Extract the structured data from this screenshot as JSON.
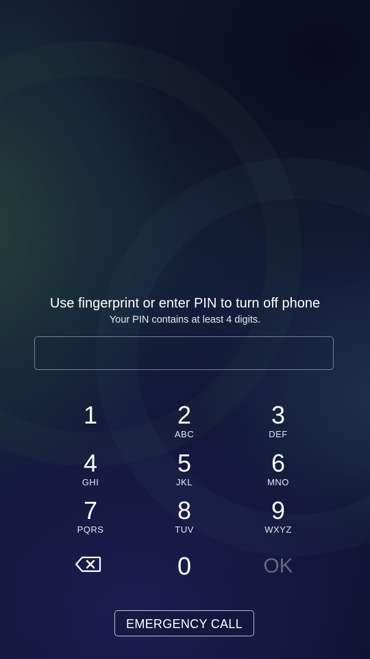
{
  "prompt": {
    "title": "Use fingerprint or enter PIN to turn off phone",
    "subtitle": "Your PIN contains at least 4 digits."
  },
  "pin_field": {
    "value": "",
    "placeholder": ""
  },
  "keypad": {
    "k1": {
      "digit": "1",
      "letters": ""
    },
    "k2": {
      "digit": "2",
      "letters": "ABC"
    },
    "k3": {
      "digit": "3",
      "letters": "DEF"
    },
    "k4": {
      "digit": "4",
      "letters": "GHI"
    },
    "k5": {
      "digit": "5",
      "letters": "JKL"
    },
    "k6": {
      "digit": "6",
      "letters": "MNO"
    },
    "k7": {
      "digit": "7",
      "letters": "PQRS"
    },
    "k8": {
      "digit": "8",
      "letters": "TUV"
    },
    "k9": {
      "digit": "9",
      "letters": "WXYZ"
    },
    "k0": {
      "digit": "0"
    },
    "ok": {
      "label": "OK"
    },
    "backspace": {
      "icon": "backspace-icon"
    }
  },
  "emergency_call": {
    "label": "EMERGENCY CALL"
  },
  "colors": {
    "text": "#ffffff",
    "ok_disabled": "#8a8c99",
    "field_border": "#c8cddc"
  }
}
